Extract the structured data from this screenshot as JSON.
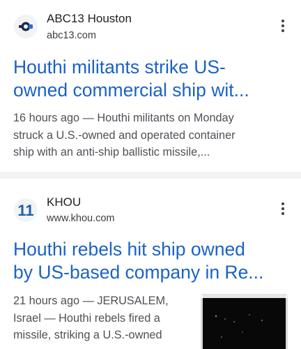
{
  "articles": [
    {
      "source": "ABC13 Houston",
      "url": "abc13.com",
      "headline_lines": [
        "Houthi militants strike US-",
        "owned commercial ship wit..."
      ],
      "snippet_lines": [
        "16 hours ago — Houthi militants on Monday",
        "struck a U.S.-owned and operated container",
        "ship with an anti-ship ballistic missile,..."
      ],
      "icon": "abc13-logo"
    },
    {
      "source": "KHOU",
      "url": "www.khou.com",
      "logo_text": "11",
      "headline_lines": [
        "Houthi rebels hit ship owned",
        "by US-based company in Re..."
      ],
      "snippet_lines": [
        "21 hours ago — JERUSALEM,",
        "Israel — Houthi rebels fired a",
        "missile, striking a U.S.-owned"
      ],
      "icon": "khou-11-logo",
      "thumbnail": "dark-night-ship-image"
    }
  ],
  "colors": {
    "headline": "#1a62c8",
    "snippet": "#4d5156",
    "source": "#202124",
    "khou_logo": "#1f5fa8",
    "separator": "#f1f3f4"
  }
}
